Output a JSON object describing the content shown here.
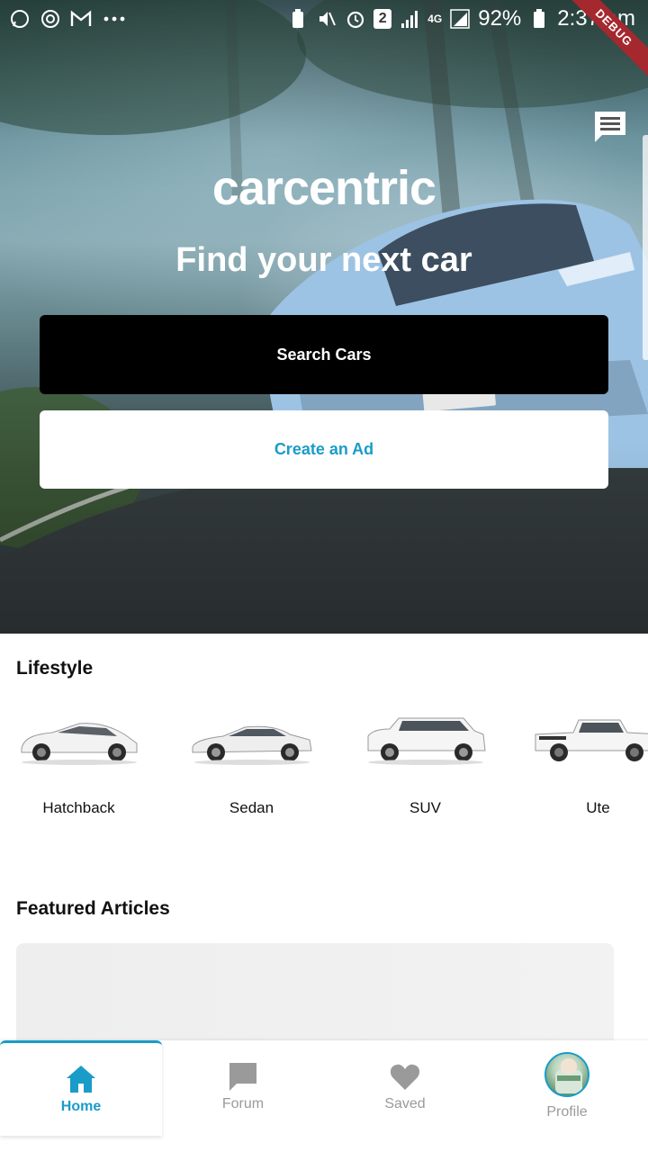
{
  "status_bar": {
    "battery": "92%",
    "time": "2:37 am",
    "network": "4G",
    "sim_badge": "2",
    "debug_label": "DEBUG"
  },
  "hero": {
    "brand": "carcentric",
    "title": "Find your next car",
    "search_button": "Search Cars",
    "create_button": "Create an Ad"
  },
  "lifestyle": {
    "title": "Lifestyle",
    "items": [
      {
        "label": "Hatchback"
      },
      {
        "label": "Sedan"
      },
      {
        "label": "SUV"
      },
      {
        "label": "Ute"
      }
    ]
  },
  "featured": {
    "title": "Featured Articles"
  },
  "bottom_nav": {
    "items": [
      {
        "label": "Home",
        "icon": "home-icon",
        "active": true
      },
      {
        "label": "Forum",
        "icon": "chat-bubble-icon",
        "active": false
      },
      {
        "label": "Saved",
        "icon": "heart-icon",
        "active": false
      },
      {
        "label": "Profile",
        "icon": "avatar",
        "active": false
      }
    ]
  },
  "colors": {
    "accent": "#1a9cc8",
    "primary_button": "#000000",
    "debug_ribbon": "#a5282f",
    "inactive": "#9a9a9a"
  }
}
